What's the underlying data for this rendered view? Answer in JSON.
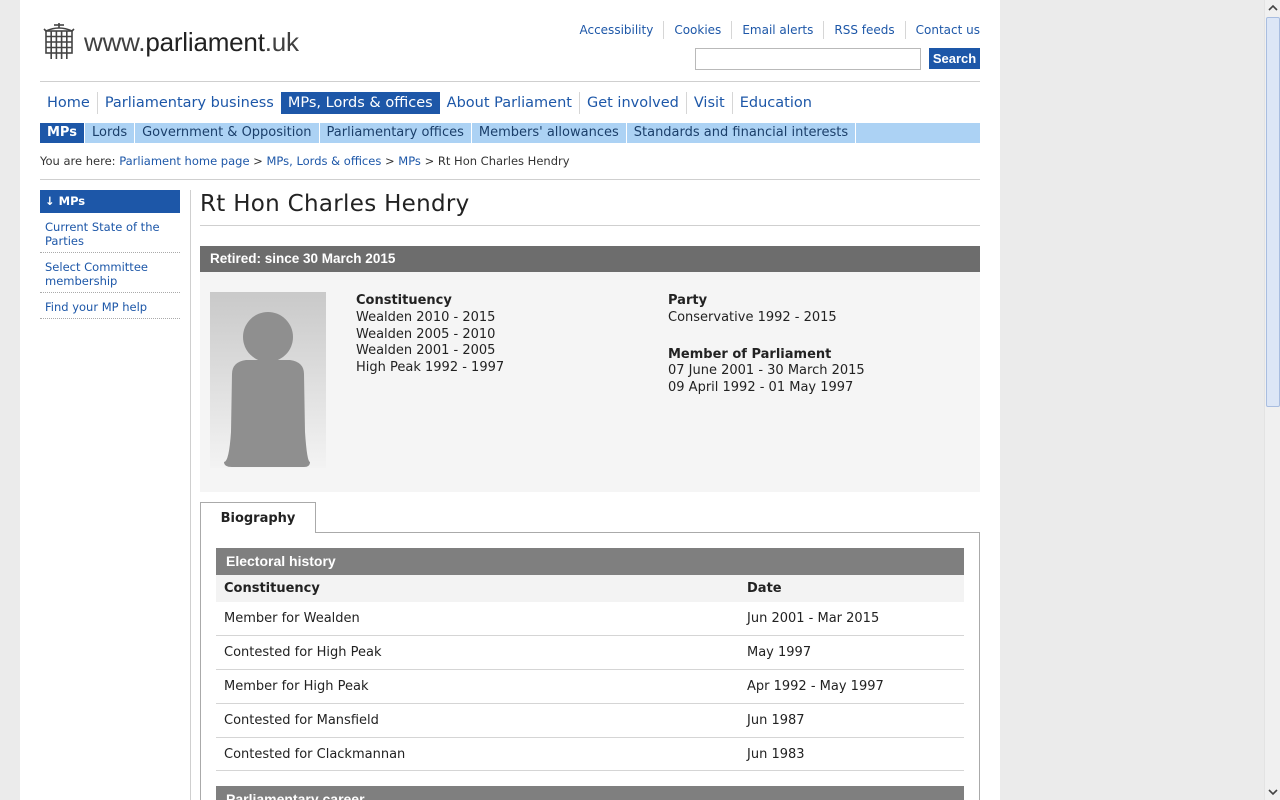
{
  "header": {
    "logo_prefix": "www.",
    "logo_main": "parliament",
    "logo_suffix": ".uk",
    "top_links": [
      "Accessibility",
      "Cookies",
      "Email alerts",
      "RSS feeds",
      "Contact us"
    ],
    "search_placeholder": "",
    "search_label": "Search"
  },
  "main_nav": [
    {
      "label": "Home",
      "active": false
    },
    {
      "label": "Parliamentary business",
      "active": false
    },
    {
      "label": "MPs, Lords & offices",
      "active": true
    },
    {
      "label": "About Parliament",
      "active": false
    },
    {
      "label": "Get involved",
      "active": false
    },
    {
      "label": "Visit",
      "active": false
    },
    {
      "label": "Education",
      "active": false
    }
  ],
  "sub_nav": [
    {
      "label": "MPs",
      "active": true
    },
    {
      "label": "Lords",
      "active": false
    },
    {
      "label": "Government & Opposition",
      "active": false
    },
    {
      "label": "Parliamentary offices",
      "active": false
    },
    {
      "label": "Members' allowances",
      "active": false
    },
    {
      "label": "Standards and financial interests",
      "active": false
    }
  ],
  "breadcrumb": {
    "prefix": "You are here:",
    "links": [
      "Parliament home page",
      "MPs, Lords & offices",
      "MPs"
    ],
    "current": "Rt Hon Charles Hendry"
  },
  "left_nav": {
    "heading": "↓ MPs",
    "items": [
      "Current State of the Parties",
      "Select Committee membership",
      "Find your MP help"
    ]
  },
  "member": {
    "name": "Rt Hon Charles Hendry",
    "status": "Retired: since 30 March 2015",
    "constituency_label": "Constituency",
    "constituencies": [
      "Wealden 2010 - 2015",
      "Wealden 2005 - 2010",
      "Wealden 2001 - 2005",
      "High Peak 1992 - 1997"
    ],
    "party_label": "Party",
    "party": "Conservative 1992 - 2015",
    "mp_label": "Member of Parliament",
    "mp_terms": [
      "07 June 2001 - 30 March 2015",
      "09 April 1992 - 01 May 1997"
    ]
  },
  "tabs": {
    "active": "Biography"
  },
  "electoral_history": {
    "heading": "Electoral history",
    "col_constituency": "Constituency",
    "col_date": "Date",
    "rows": [
      {
        "constituency": "Member for Wealden",
        "date": "Jun 2001 - Mar 2015"
      },
      {
        "constituency": "Contested for High Peak",
        "date": "May 1997"
      },
      {
        "constituency": "Member for High Peak",
        "date": "Apr 1992 - May 1997"
      },
      {
        "constituency": "Contested for Mansfield",
        "date": "Jun 1987"
      },
      {
        "constituency": "Contested for Clackmannan",
        "date": "Jun 1983"
      }
    ]
  },
  "parliamentary_career": {
    "heading": "Parliamentary career"
  },
  "colors": {
    "brand_blue": "#1d57a8",
    "subnav_bg": "#acd2f4",
    "status_bar": "#6d6d6d",
    "section_head": "#7f7f7f"
  }
}
